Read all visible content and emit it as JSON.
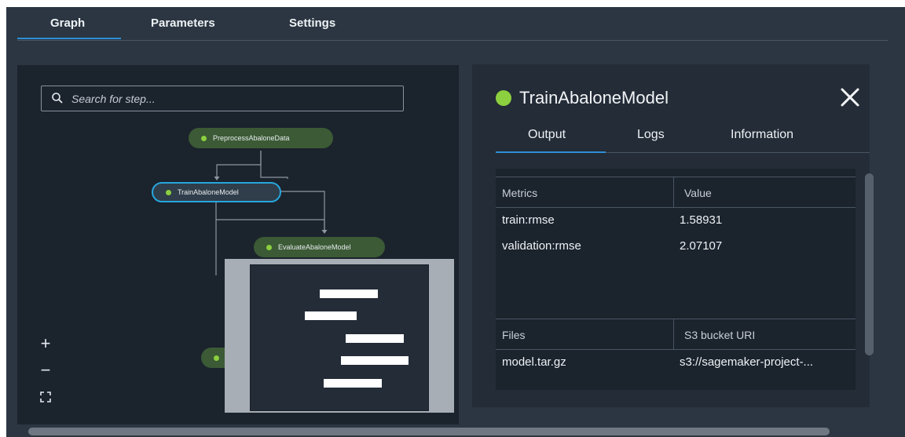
{
  "tabs": [
    {
      "label": "Graph",
      "active": true
    },
    {
      "label": "Parameters",
      "active": false
    },
    {
      "label": "Settings",
      "active": false
    }
  ],
  "graph": {
    "search_placeholder": "Search for step...",
    "nodes": [
      {
        "label": "PreprocessAbaloneData",
        "status": "succeeded"
      },
      {
        "label": "TrainAbaloneModel",
        "status": "succeeded",
        "selected": true
      },
      {
        "label": "EvaluateAbaloneModel",
        "status": "succeeded"
      }
    ],
    "zoom_controls": {
      "zoom_in": "+",
      "zoom_out": "−"
    },
    "node_color": "#3b5a35",
    "status_color": "#8ccf3f",
    "selected_border_color": "#27a6dd"
  },
  "details": {
    "title": "TrainAbaloneModel",
    "tabs": [
      {
        "label": "Output",
        "active": true
      },
      {
        "label": "Logs",
        "active": false
      },
      {
        "label": "Information",
        "active": false
      }
    ],
    "metrics_table": {
      "headers": [
        "Metrics",
        "Value"
      ],
      "rows": [
        [
          "train:rmse",
          "1.58931"
        ],
        [
          "validation:rmse",
          "2.07107"
        ]
      ]
    },
    "files_table": {
      "headers": [
        "Files",
        "S3 bucket URI"
      ],
      "rows": [
        [
          "model.tar.gz",
          "s3://sagemaker-project-..."
        ]
      ]
    }
  },
  "accent_color": "#2e8fd6"
}
